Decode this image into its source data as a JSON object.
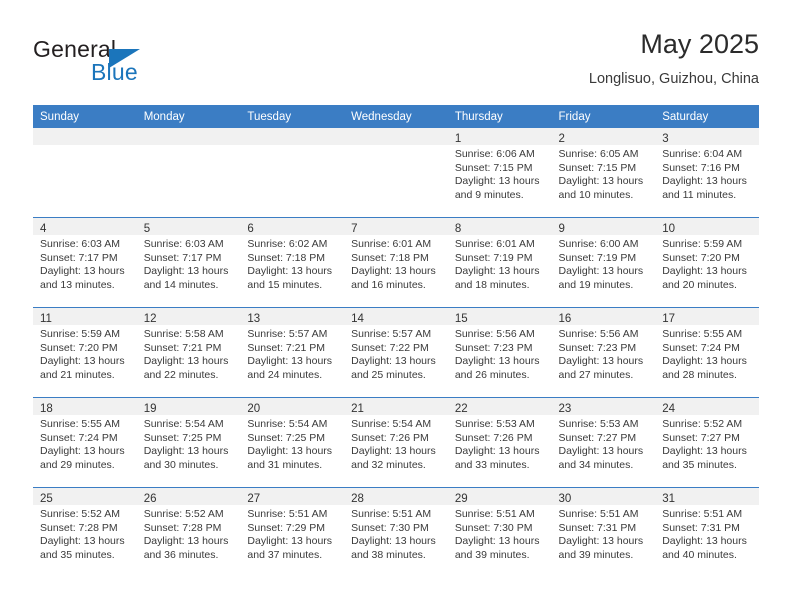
{
  "brand": {
    "word_one": "General",
    "word_two": "Blue",
    "accent_color": "#1b75bb"
  },
  "header": {
    "title": "May 2025",
    "subtitle": "Longlisuo, Guizhou, China"
  },
  "theme": {
    "header_row_color": "#3b7dc4",
    "daynum_band_color": "#f1f1f1",
    "grid_line_color": "#3b7dc4"
  },
  "weekday_headers": [
    "Sunday",
    "Monday",
    "Tuesday",
    "Wednesday",
    "Thursday",
    "Friday",
    "Saturday"
  ],
  "labels": {
    "sunrise_prefix": "Sunrise:",
    "sunset_prefix": "Sunset:",
    "daylight_prefix": "Daylight:"
  },
  "weeks": [
    [
      {
        "day": "",
        "sunrise": "",
        "sunset": "",
        "daylight_a": "",
        "daylight_b": ""
      },
      {
        "day": "",
        "sunrise": "",
        "sunset": "",
        "daylight_a": "",
        "daylight_b": ""
      },
      {
        "day": "",
        "sunrise": "",
        "sunset": "",
        "daylight_a": "",
        "daylight_b": ""
      },
      {
        "day": "",
        "sunrise": "",
        "sunset": "",
        "daylight_a": "",
        "daylight_b": ""
      },
      {
        "day": "1",
        "sunrise": "Sunrise: 6:06 AM",
        "sunset": "Sunset: 7:15 PM",
        "daylight_a": "Daylight: 13 hours",
        "daylight_b": "and 9 minutes."
      },
      {
        "day": "2",
        "sunrise": "Sunrise: 6:05 AM",
        "sunset": "Sunset: 7:15 PM",
        "daylight_a": "Daylight: 13 hours",
        "daylight_b": "and 10 minutes."
      },
      {
        "day": "3",
        "sunrise": "Sunrise: 6:04 AM",
        "sunset": "Sunset: 7:16 PM",
        "daylight_a": "Daylight: 13 hours",
        "daylight_b": "and 11 minutes."
      }
    ],
    [
      {
        "day": "4",
        "sunrise": "Sunrise: 6:03 AM",
        "sunset": "Sunset: 7:17 PM",
        "daylight_a": "Daylight: 13 hours",
        "daylight_b": "and 13 minutes."
      },
      {
        "day": "5",
        "sunrise": "Sunrise: 6:03 AM",
        "sunset": "Sunset: 7:17 PM",
        "daylight_a": "Daylight: 13 hours",
        "daylight_b": "and 14 minutes."
      },
      {
        "day": "6",
        "sunrise": "Sunrise: 6:02 AM",
        "sunset": "Sunset: 7:18 PM",
        "daylight_a": "Daylight: 13 hours",
        "daylight_b": "and 15 minutes."
      },
      {
        "day": "7",
        "sunrise": "Sunrise: 6:01 AM",
        "sunset": "Sunset: 7:18 PM",
        "daylight_a": "Daylight: 13 hours",
        "daylight_b": "and 16 minutes."
      },
      {
        "day": "8",
        "sunrise": "Sunrise: 6:01 AM",
        "sunset": "Sunset: 7:19 PM",
        "daylight_a": "Daylight: 13 hours",
        "daylight_b": "and 18 minutes."
      },
      {
        "day": "9",
        "sunrise": "Sunrise: 6:00 AM",
        "sunset": "Sunset: 7:19 PM",
        "daylight_a": "Daylight: 13 hours",
        "daylight_b": "and 19 minutes."
      },
      {
        "day": "10",
        "sunrise": "Sunrise: 5:59 AM",
        "sunset": "Sunset: 7:20 PM",
        "daylight_a": "Daylight: 13 hours",
        "daylight_b": "and 20 minutes."
      }
    ],
    [
      {
        "day": "11",
        "sunrise": "Sunrise: 5:59 AM",
        "sunset": "Sunset: 7:20 PM",
        "daylight_a": "Daylight: 13 hours",
        "daylight_b": "and 21 minutes."
      },
      {
        "day": "12",
        "sunrise": "Sunrise: 5:58 AM",
        "sunset": "Sunset: 7:21 PM",
        "daylight_a": "Daylight: 13 hours",
        "daylight_b": "and 22 minutes."
      },
      {
        "day": "13",
        "sunrise": "Sunrise: 5:57 AM",
        "sunset": "Sunset: 7:21 PM",
        "daylight_a": "Daylight: 13 hours",
        "daylight_b": "and 24 minutes."
      },
      {
        "day": "14",
        "sunrise": "Sunrise: 5:57 AM",
        "sunset": "Sunset: 7:22 PM",
        "daylight_a": "Daylight: 13 hours",
        "daylight_b": "and 25 minutes."
      },
      {
        "day": "15",
        "sunrise": "Sunrise: 5:56 AM",
        "sunset": "Sunset: 7:23 PM",
        "daylight_a": "Daylight: 13 hours",
        "daylight_b": "and 26 minutes."
      },
      {
        "day": "16",
        "sunrise": "Sunrise: 5:56 AM",
        "sunset": "Sunset: 7:23 PM",
        "daylight_a": "Daylight: 13 hours",
        "daylight_b": "and 27 minutes."
      },
      {
        "day": "17",
        "sunrise": "Sunrise: 5:55 AM",
        "sunset": "Sunset: 7:24 PM",
        "daylight_a": "Daylight: 13 hours",
        "daylight_b": "and 28 minutes."
      }
    ],
    [
      {
        "day": "18",
        "sunrise": "Sunrise: 5:55 AM",
        "sunset": "Sunset: 7:24 PM",
        "daylight_a": "Daylight: 13 hours",
        "daylight_b": "and 29 minutes."
      },
      {
        "day": "19",
        "sunrise": "Sunrise: 5:54 AM",
        "sunset": "Sunset: 7:25 PM",
        "daylight_a": "Daylight: 13 hours",
        "daylight_b": "and 30 minutes."
      },
      {
        "day": "20",
        "sunrise": "Sunrise: 5:54 AM",
        "sunset": "Sunset: 7:25 PM",
        "daylight_a": "Daylight: 13 hours",
        "daylight_b": "and 31 minutes."
      },
      {
        "day": "21",
        "sunrise": "Sunrise: 5:54 AM",
        "sunset": "Sunset: 7:26 PM",
        "daylight_a": "Daylight: 13 hours",
        "daylight_b": "and 32 minutes."
      },
      {
        "day": "22",
        "sunrise": "Sunrise: 5:53 AM",
        "sunset": "Sunset: 7:26 PM",
        "daylight_a": "Daylight: 13 hours",
        "daylight_b": "and 33 minutes."
      },
      {
        "day": "23",
        "sunrise": "Sunrise: 5:53 AM",
        "sunset": "Sunset: 7:27 PM",
        "daylight_a": "Daylight: 13 hours",
        "daylight_b": "and 34 minutes."
      },
      {
        "day": "24",
        "sunrise": "Sunrise: 5:52 AM",
        "sunset": "Sunset: 7:27 PM",
        "daylight_a": "Daylight: 13 hours",
        "daylight_b": "and 35 minutes."
      }
    ],
    [
      {
        "day": "25",
        "sunrise": "Sunrise: 5:52 AM",
        "sunset": "Sunset: 7:28 PM",
        "daylight_a": "Daylight: 13 hours",
        "daylight_b": "and 35 minutes."
      },
      {
        "day": "26",
        "sunrise": "Sunrise: 5:52 AM",
        "sunset": "Sunset: 7:28 PM",
        "daylight_a": "Daylight: 13 hours",
        "daylight_b": "and 36 minutes."
      },
      {
        "day": "27",
        "sunrise": "Sunrise: 5:51 AM",
        "sunset": "Sunset: 7:29 PM",
        "daylight_a": "Daylight: 13 hours",
        "daylight_b": "and 37 minutes."
      },
      {
        "day": "28",
        "sunrise": "Sunrise: 5:51 AM",
        "sunset": "Sunset: 7:30 PM",
        "daylight_a": "Daylight: 13 hours",
        "daylight_b": "and 38 minutes."
      },
      {
        "day": "29",
        "sunrise": "Sunrise: 5:51 AM",
        "sunset": "Sunset: 7:30 PM",
        "daylight_a": "Daylight: 13 hours",
        "daylight_b": "and 39 minutes."
      },
      {
        "day": "30",
        "sunrise": "Sunrise: 5:51 AM",
        "sunset": "Sunset: 7:31 PM",
        "daylight_a": "Daylight: 13 hours",
        "daylight_b": "and 39 minutes."
      },
      {
        "day": "31",
        "sunrise": "Sunrise: 5:51 AM",
        "sunset": "Sunset: 7:31 PM",
        "daylight_a": "Daylight: 13 hours",
        "daylight_b": "and 40 minutes."
      }
    ]
  ]
}
